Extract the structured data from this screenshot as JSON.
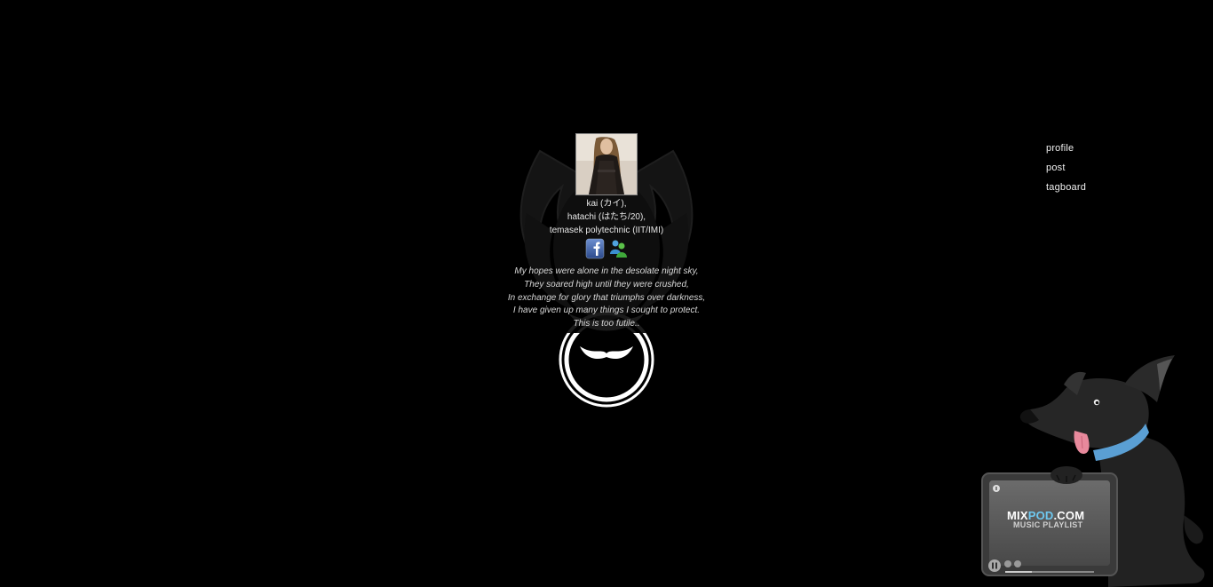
{
  "nav": {
    "items": [
      {
        "label": "profile"
      },
      {
        "label": "post"
      },
      {
        "label": "tagboard"
      }
    ]
  },
  "profile": {
    "bio": [
      "kai (カイ),",
      "hatachi (はたち/20),",
      "temasek polytechnic (IIT/IMI)"
    ],
    "social": [
      {
        "icon": "facebook-icon"
      },
      {
        "icon": "msn-messenger-icon"
      }
    ],
    "poem": [
      "My hopes were alone in the desolate night sky,",
      "They soared high until they were crushed,",
      "In exchange for glory that triumphs over darkness,",
      "I have given up many things I sought to protect.",
      "This is too futile.."
    ]
  },
  "mixpod": {
    "brand_main": "MIX",
    "brand_accent": "POD",
    "brand_end": ".COM",
    "subtitle": "MUSIC PLAYLIST",
    "accent_color": "#6ec8f0",
    "collar_color": "#5a9fd4"
  }
}
